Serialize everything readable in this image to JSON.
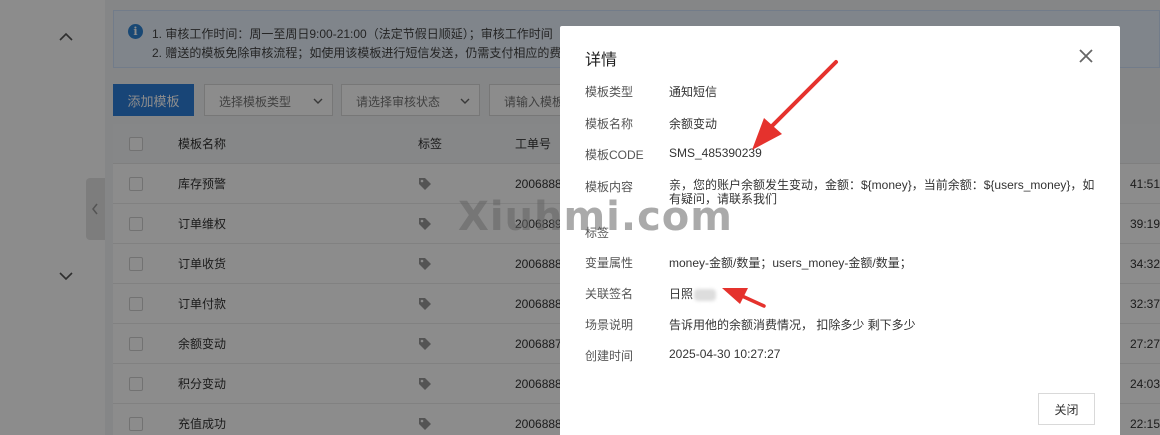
{
  "notice": {
    "line1": "1. 审核工作时间：周一至周日9:00-21:00（法定节假日顺延）；审核工作时间",
    "line2": "2. 赠送的模板免除审核流程；如使用该模板进行短信发送，仍需支付相应的费"
  },
  "toolbar": {
    "add_label": "添加模板",
    "type_select": "选择模板类型",
    "status_select": "请选择审核状态",
    "search_placeholder": "请输入模板"
  },
  "table": {
    "headers": {
      "name": "模板名称",
      "tag": "标签",
      "no": "工单号"
    },
    "rows": [
      {
        "name": "库存预警",
        "no": "2006888",
        "time": "41:51"
      },
      {
        "name": "订单维权",
        "no": "2006889",
        "time": "39:19"
      },
      {
        "name": "订单收货",
        "no": "2006888",
        "time": "34:32"
      },
      {
        "name": "订单付款",
        "no": "2006888",
        "time": "32:37"
      },
      {
        "name": "余额变动",
        "no": "2006887",
        "time": "27:27"
      },
      {
        "name": "积分变动",
        "no": "2006888",
        "time": "24:03"
      },
      {
        "name": "充值成功",
        "no": "2006888",
        "time": "22:15"
      }
    ]
  },
  "modal": {
    "title": "详情",
    "fields": {
      "type_label": "模板类型",
      "type_value": "通知短信",
      "name_label": "模板名称",
      "name_value": "余额变动",
      "code_label": "模板CODE",
      "code_value": "SMS_485390239",
      "content_label": "模板内容",
      "content_value": "亲，您的账户余额发生变动，金额：${money}，当前余额：${users_money}，如有疑问，请联系我们",
      "tag_label": "标签",
      "var_label": "变量属性",
      "var_value": "money-金额/数量；users_money-金额/数量；",
      "sign_label": "关联签名",
      "sign_value": "日照",
      "scene_label": "场景说明",
      "scene_value": "告诉用他的余额消费情况， 扣除多少 剩下多少",
      "created_label": "创建时间",
      "created_value": "2025-04-30 10:27:27"
    },
    "close_label": "关闭"
  },
  "watermark": "Xiuhmi.com",
  "colors": {
    "primary": "#2d7fd9",
    "arrow": "#e5322d",
    "notice_bg": "#e9f3fe"
  }
}
